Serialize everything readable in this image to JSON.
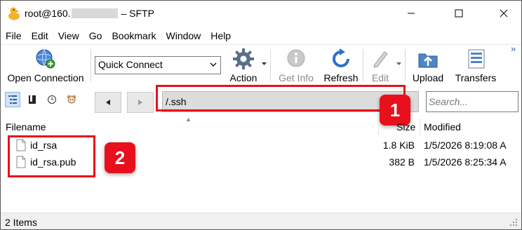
{
  "window": {
    "title_prefix": "root@160.",
    "title_suffix": "– SFTP"
  },
  "menu": [
    "File",
    "Edit",
    "View",
    "Go",
    "Bookmark",
    "Window",
    "Help"
  ],
  "toolbar": {
    "open_connection": "Open Connection",
    "quick_connect": "Quick Connect",
    "action": "Action",
    "get_info": "Get Info",
    "refresh": "Refresh",
    "edit": "Edit",
    "upload": "Upload",
    "transfers": "Transfers",
    "overflow": "»"
  },
  "pathbar": {
    "path": "/.ssh",
    "search_placeholder": "Search..."
  },
  "annotations": {
    "badge1": "1",
    "badge2": "2",
    "color": "#e8101c"
  },
  "columns": {
    "filename": "Filename",
    "size": "Size",
    "modified": "Modified"
  },
  "files": [
    {
      "name": "id_rsa",
      "size": "1.8 KiB",
      "modified": "1/5/2026 8:19:08 A"
    },
    {
      "name": "id_rsa.pub",
      "size": "382 B",
      "modified": "1/5/2026 8:25:34 A"
    }
  ],
  "status": {
    "text": "2 Items"
  },
  "icons": {
    "app": "duck-icon",
    "open_connection": "globe-plus-icon",
    "action": "gear-icon",
    "get_info": "info-icon",
    "refresh": "refresh-icon",
    "edit": "pencil-icon",
    "upload": "upload-folder-icon",
    "transfers": "transfers-icon"
  }
}
